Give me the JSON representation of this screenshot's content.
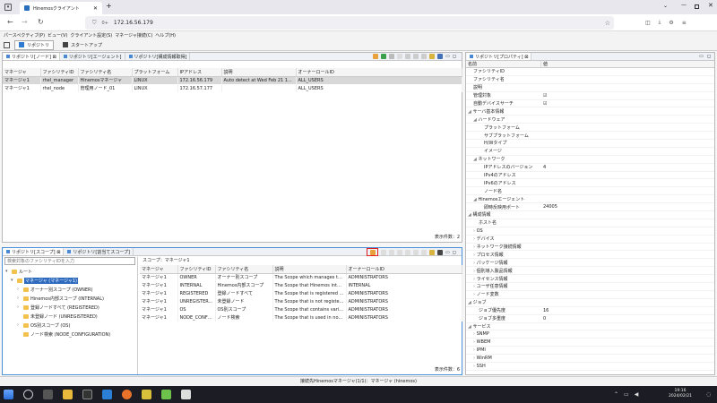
{
  "browser": {
    "tab_title": "Hinemosクライアント",
    "url_prefix": "0+",
    "url": "172.16.56.179"
  },
  "menubar": [
    "パースペクティブ(P)",
    "ビュー(V)",
    "クライアント設定(S)",
    "マネージャ接続(C)",
    "ヘルプ(H)"
  ],
  "perspectives": [
    {
      "label": "リポジトリ",
      "active": true
    },
    {
      "label": "スタートアップ",
      "active": false
    }
  ],
  "node_view": {
    "tabs": [
      {
        "label": "リポジトリ[ノード] ⊠",
        "active": true
      },
      {
        "label": "リポジトリ[エージェント]",
        "active": false
      },
      {
        "label": "リポジトリ[構成情報取得]",
        "active": false
      }
    ],
    "columns": [
      "マネージャ",
      "ファシリティID",
      "ファシリティ名",
      "プラットフォーム",
      "IPアドレス",
      "説明",
      "オーナーロールID"
    ],
    "rows": [
      [
        "マネージャ1",
        "rhel_manager",
        "Hinemosマネージャ",
        "LINUX",
        "172.16.56.179",
        "Auto detect at Wed Feb 21 1...",
        "ALL_USERS"
      ],
      [
        "マネージャ1",
        "rhel_node",
        "管理用ノード_01",
        "LINUX",
        "172.16.57.177",
        "",
        "ALL_USERS"
      ]
    ],
    "count": "表示件数：2"
  },
  "scope_view": {
    "tabs": [
      {
        "label": "リポジトリ[スコープ] ⊠",
        "active": true
      },
      {
        "label": "リポジトリ[割当てスコープ]",
        "active": false
      }
    ],
    "search_placeholder": "検索対象のファシリティIDを入力",
    "tree": [
      {
        "label": "ルート",
        "level": 0
      },
      {
        "label": "マネージャ (マネージャ1)",
        "level": 1,
        "selected": true
      },
      {
        "label": "オーナー別スコープ (OWNER)",
        "level": 2
      },
      {
        "label": "Hinemos内部スコープ (INTERNAL)",
        "level": 2
      },
      {
        "label": "登録ノードすべて (REGISTERED)",
        "level": 2
      },
      {
        "label": "未登録ノード (UNREGISTERED)",
        "level": 2
      },
      {
        "label": "OS別スコープ (OS)",
        "level": 2
      },
      {
        "label": "ノード検索 (NODE_CONFIGURATION)",
        "level": 2
      }
    ],
    "scope_label": "スコープ：マネージャ1",
    "columns": [
      "マネージャ",
      "ファシリティID",
      "ファシリティ名",
      "説明",
      "オーナーロールID"
    ],
    "rows": [
      [
        "マネージャ1",
        "OWNER",
        "オーナー別スコープ",
        "The Scope which manages th...",
        "ADMINISTRATORS"
      ],
      [
        "マネージャ1",
        "INTERNAL",
        "Hinemos内部スコープ",
        "The Scope that Hinemos inte...",
        "INTERNAL"
      ],
      [
        "マネージャ1",
        "REGISTERED",
        "登録ノードすべて",
        "The Scope that is registered ...",
        "ADMINISTRATORS"
      ],
      [
        "マネージャ1",
        "UNREGISTER...",
        "未登録ノード",
        "The Scope that is not registe...",
        "ADMINISTRATORS"
      ],
      [
        "マネージャ1",
        "OS",
        "OS別スコープ",
        "The Scope that contains vari...",
        "ADMINISTRATORS"
      ],
      [
        "マネージャ1",
        "NODE_CONFI...",
        "ノード検索",
        "The Scope that is used in no...",
        "ADMINISTRATORS"
      ]
    ],
    "count": "表示件数：6"
  },
  "property_view": {
    "tab": "リポジトリ[プロパティ] ⊠",
    "col_name": "名前",
    "col_value": "値",
    "rows": [
      {
        "k": "ファシリティID",
        "v": "",
        "d": 1
      },
      {
        "k": "ファシリティ名",
        "v": "",
        "d": 1
      },
      {
        "k": "説明",
        "v": "",
        "d": 1
      },
      {
        "k": "管理対象",
        "v": "☑",
        "d": 1
      },
      {
        "k": "自動デバイスサーチ",
        "v": "☑",
        "d": 1
      },
      {
        "k": "サーバ基本情報",
        "v": "",
        "d": 0,
        "t": "◢"
      },
      {
        "k": "ハードウェア",
        "v": "",
        "d": 1,
        "t": "◢"
      },
      {
        "k": "プラットフォーム",
        "v": "",
        "d": 3
      },
      {
        "k": "サブプラットフォーム",
        "v": "",
        "d": 3
      },
      {
        "k": "H/Wタイプ",
        "v": "",
        "d": 3
      },
      {
        "k": "イメージ",
        "v": "",
        "d": 3
      },
      {
        "k": "ネットワーク",
        "v": "",
        "d": 1,
        "t": "◢"
      },
      {
        "k": "IPアドレスのバージョン",
        "v": "4",
        "d": 3
      },
      {
        "k": "IPv4のアドレス",
        "v": "",
        "d": 3
      },
      {
        "k": "IPv6のアドレス",
        "v": "",
        "d": 3
      },
      {
        "k": "ノード名",
        "v": "",
        "d": 3
      },
      {
        "k": "Hinemosエージェント",
        "v": "",
        "d": 1,
        "t": "◢"
      },
      {
        "k": "即時反映用ポート",
        "v": "24005",
        "d": 3
      },
      {
        "k": "構成情報",
        "v": "",
        "d": 0,
        "t": "◢"
      },
      {
        "k": "ホスト名",
        "v": "",
        "d": 2
      },
      {
        "k": "OS",
        "v": "",
        "d": 1,
        "t": "›"
      },
      {
        "k": "デバイス",
        "v": "",
        "d": 1,
        "t": "›"
      },
      {
        "k": "ネットワーク接続情報",
        "v": "",
        "d": 1,
        "t": "›"
      },
      {
        "k": "プロセス情報",
        "v": "",
        "d": 1,
        "t": "›"
      },
      {
        "k": "パッケージ情報",
        "v": "",
        "d": 1,
        "t": "›"
      },
      {
        "k": "個別導入製品情報",
        "v": "",
        "d": 1,
        "t": "›"
      },
      {
        "k": "ライセンス情報",
        "v": "",
        "d": 1,
        "t": "›"
      },
      {
        "k": "ユーザ任意情報",
        "v": "",
        "d": 1,
        "t": "›"
      },
      {
        "k": "ノード変数",
        "v": "",
        "d": 1,
        "t": "›"
      },
      {
        "k": "ジョブ",
        "v": "",
        "d": 0,
        "t": "◢"
      },
      {
        "k": "ジョブ優先度",
        "v": "16",
        "d": 2
      },
      {
        "k": "ジョブ多重度",
        "v": "0",
        "d": 2
      },
      {
        "k": "サービス",
        "v": "",
        "d": 0,
        "t": "◢"
      },
      {
        "k": "SNMP",
        "v": "",
        "d": 1,
        "t": "›"
      },
      {
        "k": "WBEM",
        "v": "",
        "d": 1,
        "t": "›"
      },
      {
        "k": "IPMI",
        "v": "",
        "d": 1,
        "t": "›"
      },
      {
        "k": "WinRM",
        "v": "",
        "d": 1,
        "t": "›"
      },
      {
        "k": "SSH",
        "v": "",
        "d": 1,
        "t": "›"
      }
    ]
  },
  "statusbar": {
    "text": "接続先Hinemosマネージャ(1/1)：マネージャ (hinemos)"
  },
  "taskbar": {
    "time": "19:16",
    "date": "2024/02/21"
  },
  "colors": {
    "highlight": "#e02020",
    "selection": "#d8d8d8"
  }
}
